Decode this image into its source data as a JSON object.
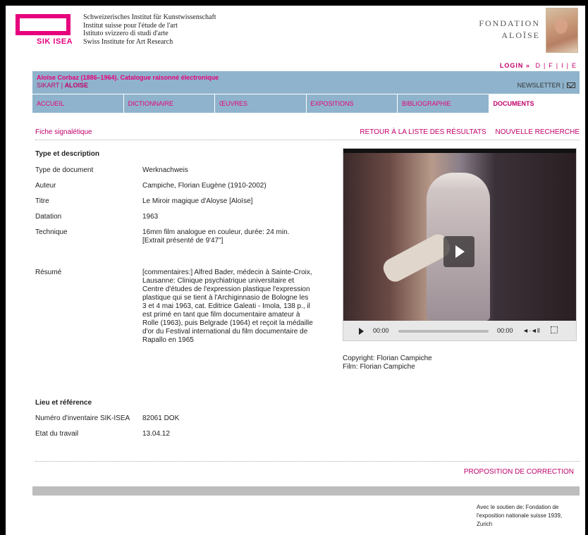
{
  "header": {
    "logo": "SIK ISEA",
    "institute_lines": [
      "Schweizerisches Institut für Kunstwissenschaft",
      "Institut suisse pour l'étude de l'art",
      "Istituto svizzero di studi d'arte",
      "Swiss Institute for Art Research"
    ],
    "fondation_line1": "FONDATION",
    "fondation_line2": "ALOÏSE"
  },
  "lang": {
    "login": "LOGIN »",
    "d": "D",
    "f": "F",
    "i": "I",
    "e": "E",
    "sep": "|"
  },
  "banner": {
    "catalog": "Aloïse Corbaz (1886–1964). Catalogue raisonné électronique",
    "crumb1": "SIKART",
    "crumb_sep": "|",
    "crumb2": "ALOISE",
    "newsletter": "NEWSLETTER |"
  },
  "nav": [
    {
      "label": "ACCUEIL"
    },
    {
      "label": "DICTIONNAIRE"
    },
    {
      "label": "ŒUVRES"
    },
    {
      "label": "EXPOSITIONS"
    },
    {
      "label": "BIBLIOGRAPHIE"
    },
    {
      "label": "DOCUMENTS"
    }
  ],
  "sub": {
    "fiche": "Fiche signalétique",
    "retour": "RETOUR À LA LISTE DES RÉSULTATS",
    "nouvelle": "NOUVELLE RECHERCHE"
  },
  "section1": "Type et description",
  "details": [
    {
      "label": "Type de document",
      "value": "Werknachweis"
    },
    {
      "label": "Auteur",
      "value": "Campiche, Florian Eugène (1910-2002)"
    },
    {
      "label": "Titre",
      "value": "Le Miroir magique d'Aloyse [Aloïse]"
    },
    {
      "label": "Datation",
      "value": "1963"
    },
    {
      "label": "Technique",
      "value": "16mm film analogue en couleur, durée: 24 min. [Extrait présenté de 9'47\"]"
    },
    {
      "label": "Résumé",
      "value": "[commentaires:] Alfred Bader, médecin à Sainte-Croix, Lausanne: Clinique psychiatrique universitaire et Centre d'études de l'expression plastique l'expression plastique qui se tient à l'Archiginnasio de Bologne les 3 et 4 mai 1963, cat. Editrice Galeati - Imola, 138 p., il est primé en tant que film documentaire amateur à Rolle (1963), puis Belgrade (1964) et reçoit la médaille d'or du Festival international du film documentaire de Rapallo en 1965"
    }
  ],
  "section2": "Lieu et référence",
  "refs": [
    {
      "label": "Numéro d'inventaire SIK-ISEA",
      "value": "82061 DOK"
    },
    {
      "label": "Etat du travail",
      "value": "13.04.12"
    }
  ],
  "video": {
    "time_current": "00:00",
    "time_total": "00:00",
    "volume": "◄·◄ll"
  },
  "copyright_line1": "Copyright: Florian Campiche",
  "copyright_line2": "Film: Florian Campiche",
  "correction": "PROPOSITION DE CORRECTION",
  "support": "Avec le soutien de: Fondation de l'exposition nationale suisse 1939, Zurich"
}
